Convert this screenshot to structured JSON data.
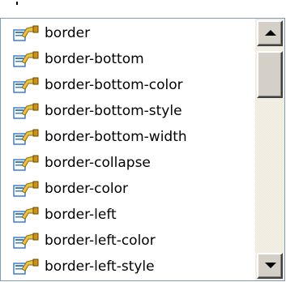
{
  "autocomplete": {
    "items": [
      {
        "label": "border",
        "icon": "css-property-icon"
      },
      {
        "label": "border-bottom",
        "icon": "css-property-icon"
      },
      {
        "label": "border-bottom-color",
        "icon": "css-property-icon"
      },
      {
        "label": "border-bottom-style",
        "icon": "css-property-icon"
      },
      {
        "label": "border-bottom-width",
        "icon": "css-property-icon"
      },
      {
        "label": "border-collapse",
        "icon": "css-property-icon"
      },
      {
        "label": "border-color",
        "icon": "css-property-icon"
      },
      {
        "label": "border-left",
        "icon": "css-property-icon"
      },
      {
        "label": "border-left-color",
        "icon": "css-property-icon"
      },
      {
        "label": "border-left-style",
        "icon": "css-property-icon"
      }
    ]
  },
  "colors": {
    "border": "#7f9db9",
    "scrollbar_track": "#ece9d8",
    "scrollbar_button": "#d4d0c8",
    "icon_hand": "#f0c040",
    "icon_card": "#3f7fc8"
  }
}
